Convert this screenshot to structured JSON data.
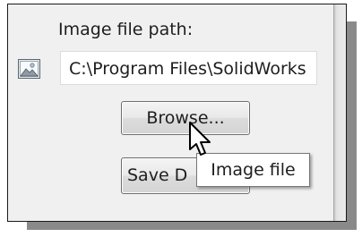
{
  "dialog": {
    "image_path_label": "Image file path:",
    "image_path_value": "C:\\Program Files\\SolidWorks",
    "browse_label": "Browse...",
    "save_label": "Save D",
    "tooltip_text": "Image file"
  },
  "icons": {
    "image": "image-file-icon",
    "cursor": "arrow-pointer-icon"
  },
  "colors": {
    "panel_background": "#f0f0f0",
    "frame_border": "#1a1a1a",
    "shadow": "#8a8a8a",
    "text": "#1e1e1e"
  }
}
